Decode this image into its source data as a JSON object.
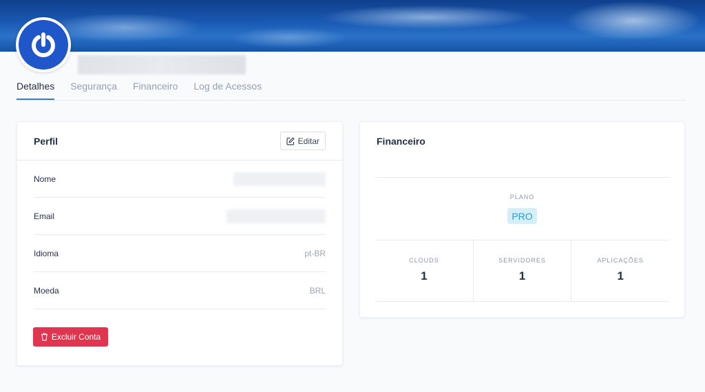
{
  "profile": {
    "avatar_icon": "power-icon"
  },
  "tabs": [
    {
      "label": "Detalhes",
      "active": true
    },
    {
      "label": "Segurança",
      "active": false
    },
    {
      "label": "Financeiro",
      "active": false
    },
    {
      "label": "Log de Acessos",
      "active": false
    }
  ],
  "perfil": {
    "title": "Perfil",
    "edit_label": "Editar",
    "fields": [
      {
        "label": "Nome",
        "value": ""
      },
      {
        "label": "Email",
        "value": ""
      },
      {
        "label": "Idioma",
        "value": "pt-BR"
      },
      {
        "label": "Moeda",
        "value": "BRL"
      }
    ],
    "delete_label": "Excluir Conta"
  },
  "financeiro": {
    "title": "Financeiro",
    "plan_label": "PLANO",
    "plan_value": "PRO",
    "stats": [
      {
        "label": "CLOUDS",
        "value": "1"
      },
      {
        "label": "SERVIDORES",
        "value": "1"
      },
      {
        "label": "APLICAÇÕES",
        "value": "1"
      }
    ]
  },
  "colors": {
    "accent": "#3b7bd8",
    "danger": "#e0354f",
    "badge_bg": "#d5eef8",
    "badge_text": "#2e9ccc"
  }
}
